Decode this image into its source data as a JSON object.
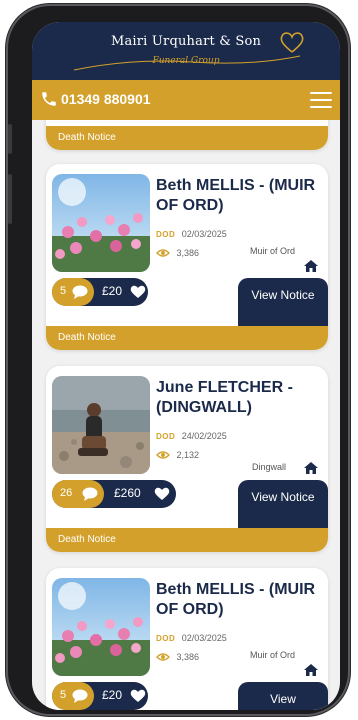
{
  "header": {
    "brand_name": "Mairi Urquhart & Son",
    "brand_sub": "Funeral Group",
    "phone": "01349 880901"
  },
  "top_card": {
    "tag": "Death Notice"
  },
  "notices": [
    {
      "name": "Beth MELLIS - (MUIR OF ORD)",
      "dod": "DOD",
      "date": "02/03/2025",
      "views": "3,386",
      "location": "Muir of Ord",
      "candles": "5",
      "donations": "£20",
      "button": "View Notice",
      "tag": "Death Notice"
    },
    {
      "name": "June FLETCHER - (DINGWALL)",
      "dod": "DOD",
      "date": "24/02/2025",
      "views": "2,132",
      "location": "Dingwall",
      "candles": "26",
      "donations": "£260",
      "button": "View Notice",
      "tag": "Death Notice"
    },
    {
      "name": "Beth MELLIS - (MUIR OF ORD)",
      "dod": "DOD",
      "date": "02/03/2025",
      "views": "3,386",
      "location": "Muir of Ord",
      "candles": "5",
      "donations": "£20",
      "button": "View"
    }
  ],
  "colors": {
    "navy": "#1b2a4a",
    "gold": "#d3a12b"
  }
}
